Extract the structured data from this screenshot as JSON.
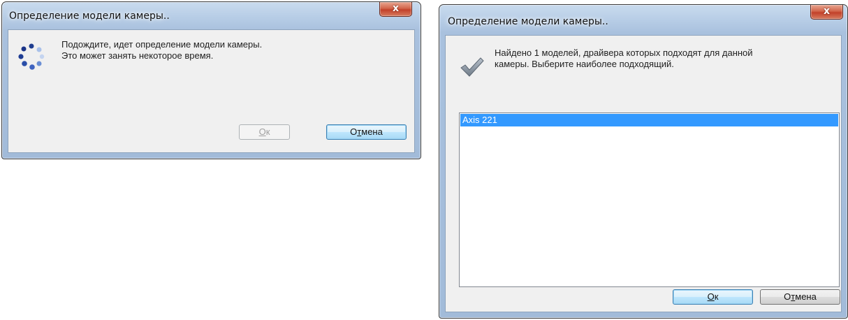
{
  "dialog_detecting": {
    "title": "Определение модели камеры..",
    "message_line1": "Подождите, идет определение модели камеры.",
    "message_line2": "Это может занять некоторое время.",
    "ok_label_mnemonic": "О",
    "ok_label_rest": "к",
    "cancel_label_pre": "О",
    "cancel_label_mnemonic": "т",
    "cancel_label_rest": "мена",
    "ok_enabled": false,
    "spinner_icon": "busy-spinner-icon"
  },
  "dialog_found": {
    "title": "Определение модели камеры..",
    "message_line1": "Найдено 1 моделей, драйвера которых подходят для данной",
    "message_line2": "камеры. Выберите наиболее подходящий.",
    "list_items": [
      "Axis 221"
    ],
    "selected_index": 0,
    "ok_label_mnemonic": "О",
    "ok_label_rest": "к",
    "cancel_label_pre": "О",
    "cancel_label_mnemonic": "т",
    "cancel_label_rest": "мена",
    "status_icon": "checkmark-icon"
  },
  "colors": {
    "selection": "#3399ff",
    "close_button": "#c7503a",
    "default_button_border": "#3c7fb1"
  }
}
